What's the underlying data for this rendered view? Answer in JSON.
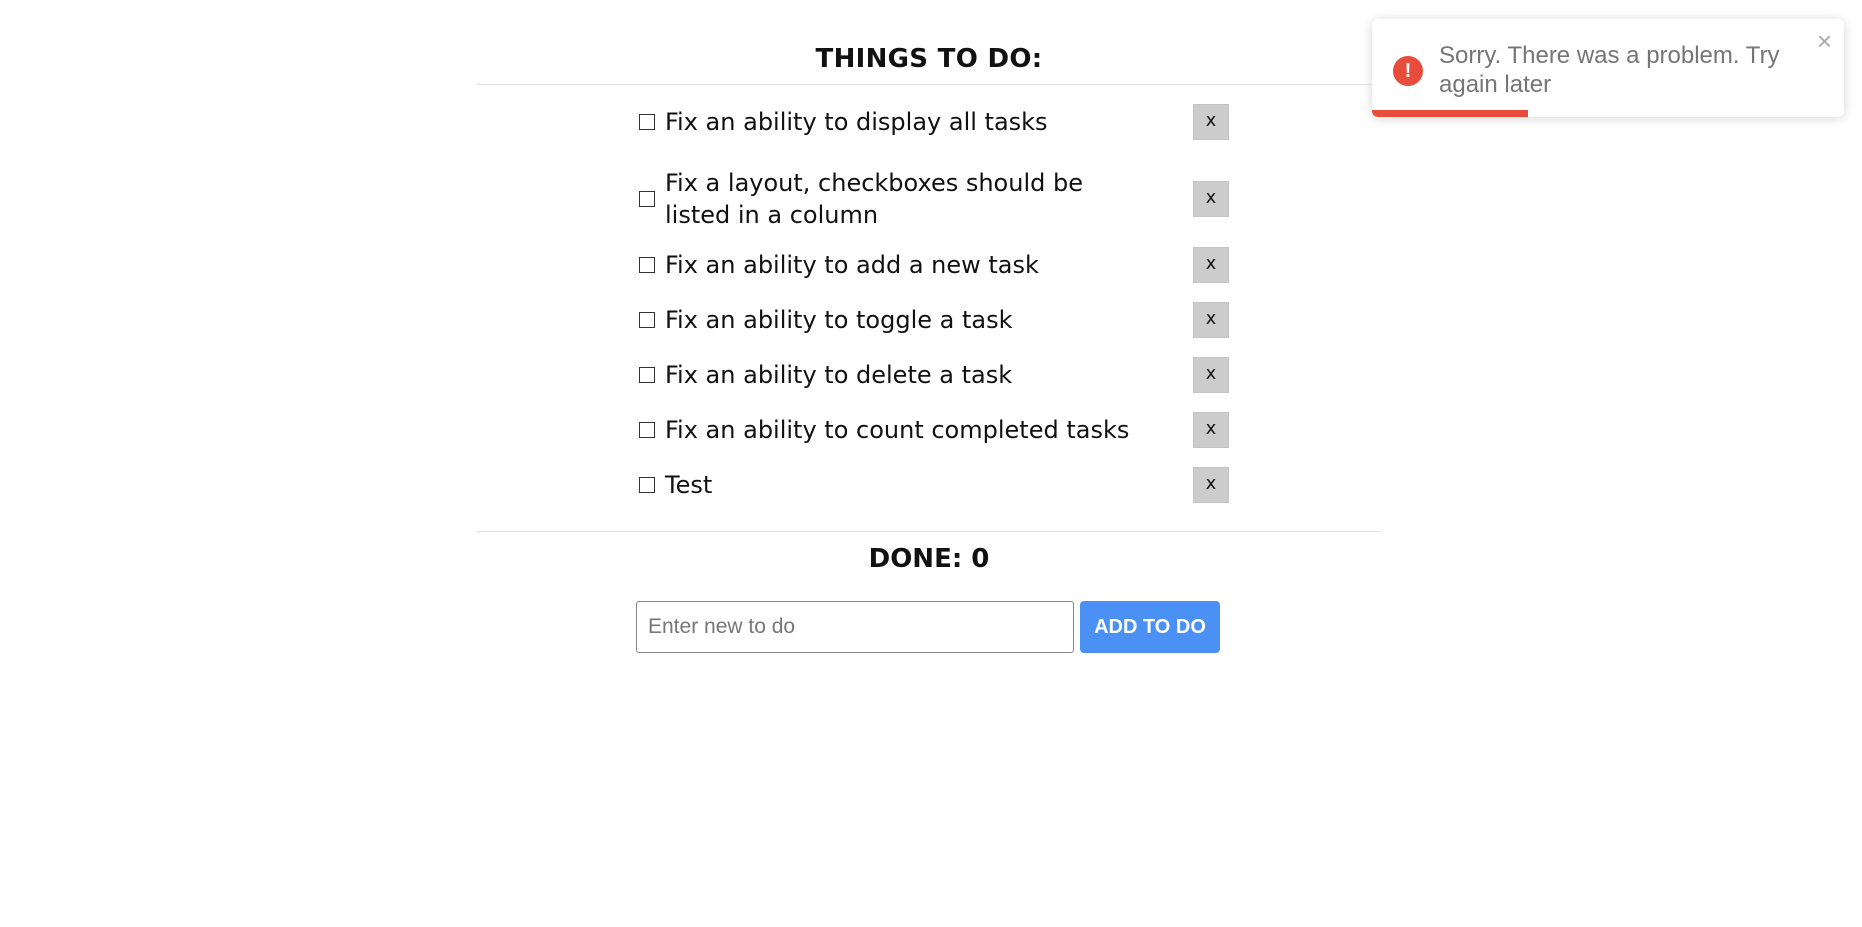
{
  "app": {
    "title": "THINGS TO DO:",
    "done_label": "DONE: 0"
  },
  "tasks": [
    {
      "text": "Fix an ability to display all tasks",
      "checked": false,
      "delete_label": "x"
    },
    {
      "text": "Fix a layout, checkboxes should be listed in a column",
      "checked": false,
      "delete_label": "x"
    },
    {
      "text": "Fix an ability to add a new task",
      "checked": false,
      "delete_label": "x"
    },
    {
      "text": "Fix an ability to toggle a task",
      "checked": false,
      "delete_label": "x"
    },
    {
      "text": "Fix an ability to delete a task",
      "checked": false,
      "delete_label": "x"
    },
    {
      "text": "Fix an ability to count completed tasks",
      "checked": false,
      "delete_label": "x"
    },
    {
      "text": "Test",
      "checked": false,
      "delete_label": "x"
    }
  ],
  "add_form": {
    "input_value": "",
    "placeholder": "Enter new to do",
    "button_label": "ADD TO DO",
    "button_color": "#4a90f5"
  },
  "toast": {
    "icon": "error-icon",
    "icon_glyph": "!",
    "message": "Sorry. There was a problem. Try again later",
    "close_glyph": "×",
    "progress_fraction": 0.33,
    "color": "#e74c3c"
  }
}
